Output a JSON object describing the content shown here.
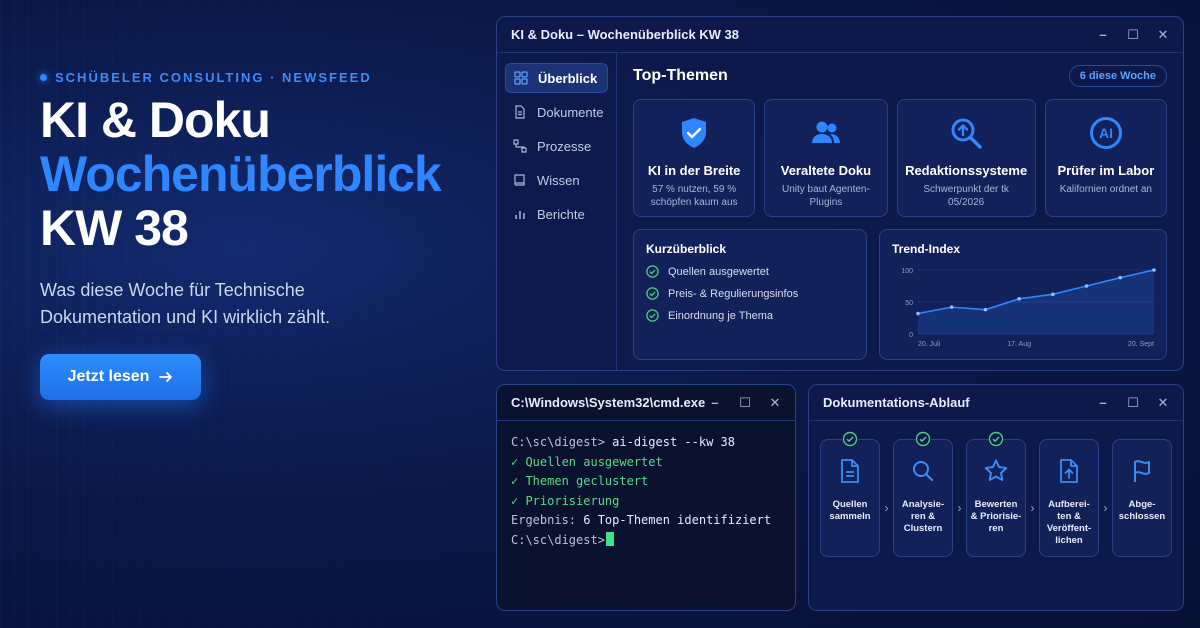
{
  "hero": {
    "eyebrow": "SCHÜBELER CONSULTING · NEWSFEED",
    "title_line1": "KI & Doku",
    "title_line2": "Wochenüberblick",
    "title_line3": "KW 38",
    "subtitle": "Was diese Woche für Technische Dokumentation und KI wirklich zählt.",
    "cta_label": "Jetzt lesen",
    "cta_icon": "arrow-right-icon"
  },
  "main_window": {
    "title": "KI & Doku – Wochenüberblick KW 38",
    "controls": [
      "–",
      "☐",
      "✕"
    ],
    "sidebar": [
      {
        "label": "Überblick",
        "icon": "grid-icon",
        "active": true
      },
      {
        "label": "Dokumente",
        "icon": "document-icon",
        "active": false
      },
      {
        "label": "Prozesse",
        "icon": "process-icon",
        "active": false
      },
      {
        "label": "Wissen",
        "icon": "book-icon",
        "active": false
      },
      {
        "label": "Berichte",
        "icon": "bar-chart-icon",
        "active": false
      }
    ],
    "section_title": "Top-Themen",
    "badge": "6 diese Woche",
    "topics": [
      {
        "title": "KI in der Breite",
        "desc": "57 % nutzen, 59 % schöpfen kaum aus",
        "icon": "shield-check-icon"
      },
      {
        "title": "Veraltete Doku",
        "desc": "Unity baut Agenten-Plugins",
        "icon": "users-icon"
      },
      {
        "title": "Redaktionssysteme",
        "desc": "Schwerpunkt der tk 05/2026",
        "icon": "search-upload-icon"
      },
      {
        "title": "Prüfer im Labor",
        "desc": "Kalifornien ordnet an",
        "icon": "ai-icon"
      }
    ],
    "summary": {
      "title": "Kurzüberblick",
      "items": [
        "Quellen ausgewertet",
        "Preis- & Regulierungsinfos",
        "Einordnung je Thema"
      ]
    },
    "trend": {
      "title": "Trend-Index",
      "accent": "#2f86ff"
    }
  },
  "chart_data": {
    "type": "area",
    "title": "Trend-Index",
    "x": [
      "20. Juli",
      "",
      "",
      "17. Aug",
      "",
      "",
      "",
      "20. Sept"
    ],
    "y": [
      32,
      42,
      38,
      55,
      62,
      75,
      88,
      100
    ],
    "ylim": [
      0,
      100
    ],
    "yticks": [
      0,
      50,
      100
    ],
    "xtick_labels": [
      "20. Juli",
      "17. Aug",
      "20. Sept"
    ]
  },
  "cmd_window": {
    "title": "C:\\Windows\\System32\\cmd.exe",
    "controls": [
      "–",
      "☐",
      "✕"
    ],
    "prompt": "C:\\sc\\digest>",
    "command": " ai-digest --kw 38",
    "ok_lines": [
      "✓ Quellen ausgewertet",
      "✓ Themen geclustert",
      "✓ Priorisierung"
    ],
    "result_label": "Ergebnis:",
    "result_value": " 6 Top-Themen identifiziert",
    "final_prompt": "C:\\sc\\digest>"
  },
  "flow_window": {
    "title": "Dokumentations-Ablauf",
    "controls": [
      "–",
      "☐",
      "✕"
    ],
    "steps": [
      {
        "label": "Quellen sammeln",
        "icon": "document-icon",
        "done": true
      },
      {
        "label": "Analysie-ren & Clustern",
        "icon": "search-icon",
        "done": true
      },
      {
        "label": "Bewerten & Priorisie-ren",
        "icon": "star-icon",
        "done": true
      },
      {
        "label": "Aufberei-ten & Veröffent-lichen",
        "icon": "upload-icon",
        "done": false
      },
      {
        "label": "Abge-schlossen",
        "icon": "flag-icon",
        "done": false
      }
    ]
  }
}
